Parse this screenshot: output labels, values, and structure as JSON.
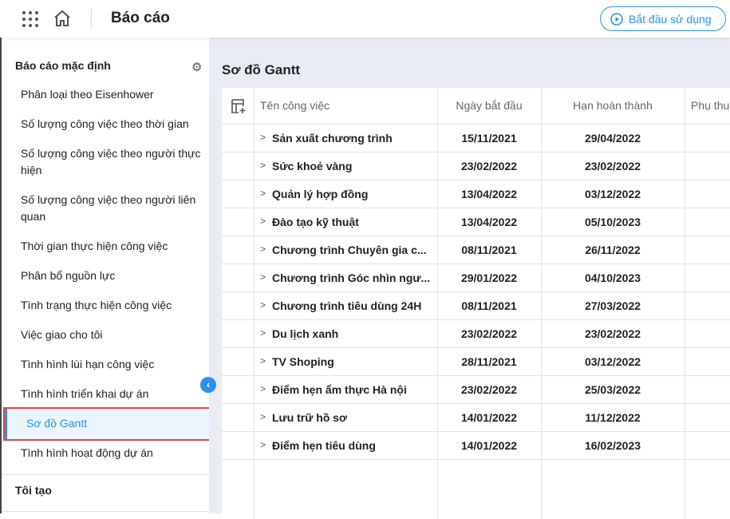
{
  "header": {
    "title": "Báo cáo",
    "start_button": "Bắt đầu sử dụng"
  },
  "sidebar": {
    "section_default": "Báo cáo mặc định",
    "section_mine": "Tôi tạo",
    "items": [
      "Phân loại theo Eisenhower",
      "Số lượng công việc theo thời gian",
      "Số lượng công việc theo người thực hiện",
      "Số lượng công việc theo người liên quan",
      "Thời gian thực hiện công việc",
      "Phân bổ nguồn lực",
      "Tình trạng thực hiện công việc",
      "Việc giao cho tôi",
      "Tình hình lùi hạn công việc",
      "Tình hình triển khai dự án",
      "Sơ đồ Gantt",
      "Tình hình hoạt động dự án"
    ]
  },
  "main": {
    "title": "Sơ đồ Gantt",
    "columns": [
      "Tên công việc",
      "Ngày bắt đầu",
      "Hạn hoàn thành",
      "Phụ thu"
    ],
    "rows": [
      [
        "Sản xuất chương trình",
        "15/11/2021",
        "29/04/2022"
      ],
      [
        "Sức khoẻ vàng",
        "23/02/2022",
        "23/02/2022"
      ],
      [
        "Quản lý hợp đồng",
        "13/04/2022",
        "03/12/2022"
      ],
      [
        "Đào tạo kỹ thuật",
        "13/04/2022",
        "05/10/2023"
      ],
      [
        "Chương trình Chuyên gia c...",
        "08/11/2021",
        "26/11/2022"
      ],
      [
        "Chương trình Góc nhìn ngư...",
        "29/01/2022",
        "04/10/2023"
      ],
      [
        "Chương trình tiêu dùng 24H",
        "08/11/2021",
        "27/03/2022"
      ],
      [
        "Du lịch xanh",
        "23/02/2022",
        "23/02/2022"
      ],
      [
        "TV Shoping",
        "28/11/2021",
        "03/12/2022"
      ],
      [
        "Điểm hẹn ẩm thực Hà nội",
        "23/02/2022",
        "25/03/2022"
      ],
      [
        "Lưu trữ hồ sơ",
        "14/01/2022",
        "11/12/2022"
      ],
      [
        "Điểm hẹn tiêu dùng",
        "14/01/2022",
        "16/02/2023"
      ]
    ]
  }
}
